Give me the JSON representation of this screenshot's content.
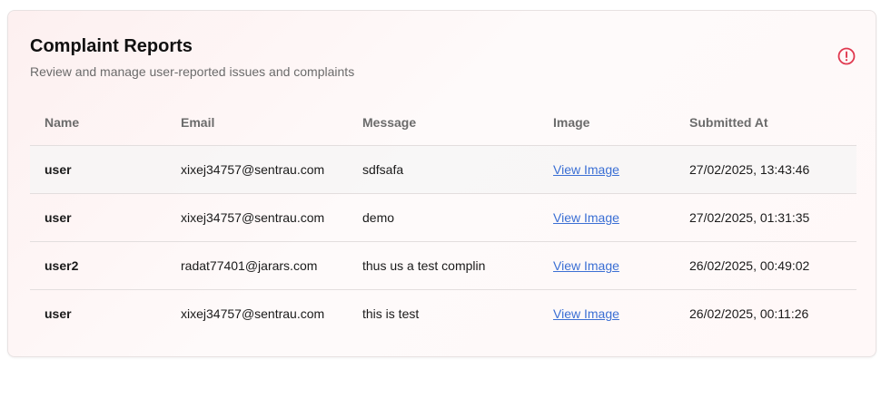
{
  "header": {
    "title": "Complaint Reports",
    "subtitle": "Review and manage user-reported issues and complaints",
    "icon": "alert-circle-icon",
    "icon_color": "#e0384f"
  },
  "table": {
    "columns": [
      "Name",
      "Email",
      "Message",
      "Image",
      "Submitted At"
    ],
    "rows": [
      {
        "name": "user",
        "email": "xixej34757@sentrau.com",
        "message": "sdfsafa",
        "image": "View Image",
        "submitted_at": "27/02/2025, 13:43:46"
      },
      {
        "name": "user",
        "email": "xixej34757@sentrau.com",
        "message": "demo",
        "image": "View Image",
        "submitted_at": "27/02/2025, 01:31:35"
      },
      {
        "name": "user2",
        "email": "radat77401@jarars.com",
        "message": "thus us a test complin",
        "image": "View Image",
        "submitted_at": "26/02/2025, 00:49:02"
      },
      {
        "name": "user",
        "email": "xixej34757@sentrau.com",
        "message": "this is test",
        "image": "View Image",
        "submitted_at": "26/02/2025, 00:11:26"
      }
    ]
  },
  "colors": {
    "link": "#3b6fd4",
    "card_tint": "#fdf0f0"
  }
}
